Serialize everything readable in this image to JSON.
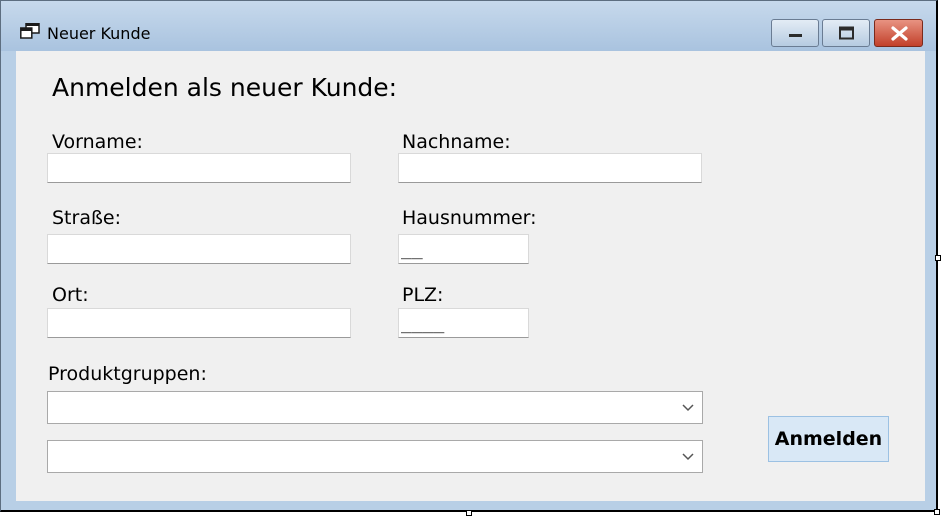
{
  "window": {
    "title": "Neuer Kunde",
    "accent": "#a9c3df",
    "close_color": "#c2402a"
  },
  "form": {
    "heading": "Anmelden als neuer Kunde:",
    "vorname": {
      "label": "Vorname:",
      "value": ""
    },
    "nachname": {
      "label": "Nachname:",
      "value": ""
    },
    "strasse": {
      "label": "Straße:",
      "value": ""
    },
    "hausnummer": {
      "label": "Hausnummer:",
      "value": "__"
    },
    "ort": {
      "label": "Ort:",
      "value": ""
    },
    "plz": {
      "label": "PLZ:",
      "value": "____"
    },
    "produktgruppen": {
      "label": "Produktgruppen:",
      "combo1_value": "",
      "combo2_value": ""
    },
    "submit_label": "Anmelden"
  },
  "icons": {
    "app": "app-windows-icon",
    "minimize": "minimize-icon",
    "maximize": "maximize-icon",
    "close": "close-icon",
    "dropdown": "chevron-down-icon"
  }
}
